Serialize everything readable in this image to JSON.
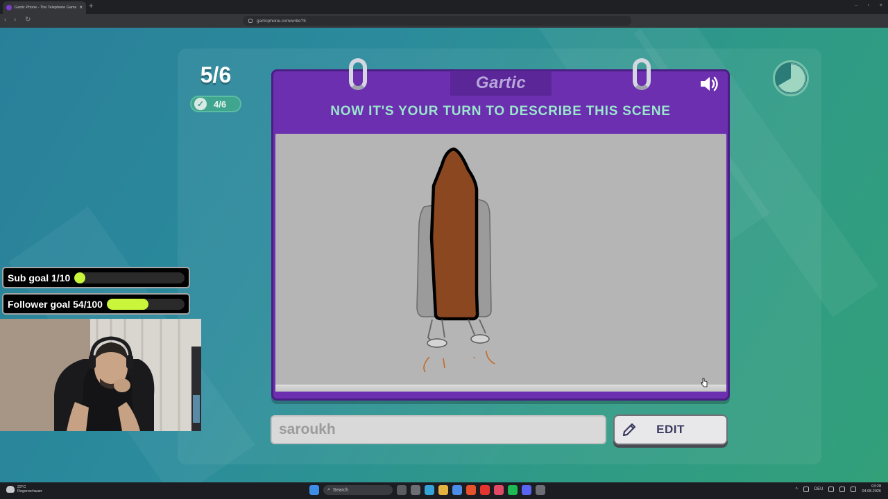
{
  "browser": {
    "tab_title": "Gartic Phone - The Telephone Game",
    "url": "garticphone.com/write?5"
  },
  "game": {
    "round_counter": "5/6",
    "done_count": "4/6",
    "logo_text": "Gartic",
    "instruction": "NOW IT'S YOUR TURN TO DESCRIBE THIS SCENE",
    "answer_value": "saroukh",
    "edit_label": "EDIT"
  },
  "overlay": {
    "sub_goal": {
      "label": "Sub goal 1/10",
      "progress": 0.1
    },
    "follower_goal": {
      "label": "Follower goal 54/100",
      "progress": 0.54
    }
  },
  "taskbar": {
    "weather_temp": "23°C",
    "weather_desc": "Regenschauer",
    "search_label": "Search",
    "language": "DEU",
    "time": "03:28",
    "date": "04.08.2026"
  },
  "colors": {
    "card_purple": "#6b2fb0",
    "instruction_green": "#9be6cd",
    "goal_fill": "#c9f53a",
    "rocket_brown": "#8b4720"
  },
  "icons": {
    "sound": "speaker-icon",
    "timer": "timer-icon",
    "check": "check-icon",
    "edit": "pencil-icon"
  }
}
